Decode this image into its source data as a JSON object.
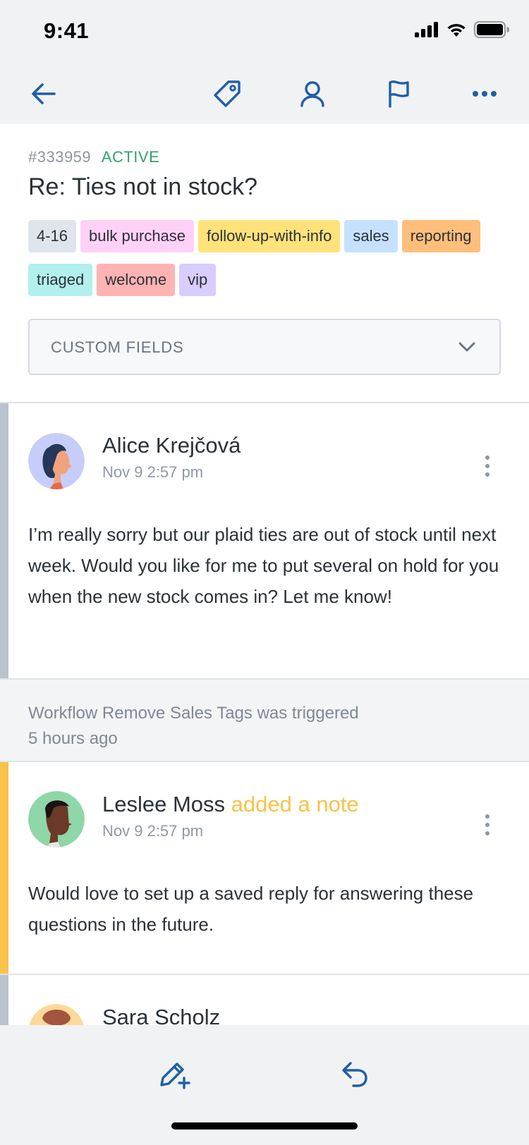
{
  "status_bar": {
    "time": "9:41"
  },
  "nav": {
    "icons": [
      "back-arrow-icon",
      "tag-icon",
      "user-icon",
      "flag-icon",
      "more-horizontal-icon"
    ],
    "accent": "#1f5fa6"
  },
  "conversation": {
    "id": "#333959",
    "status": "ACTIVE",
    "subject": "Re: Ties not in stock?",
    "tags": [
      {
        "label": "4-16",
        "color": "#dfe5eb"
      },
      {
        "label": "bulk purchase",
        "color": "#ffd1f7"
      },
      {
        "label": "follow-up-with-info",
        "color": "#ffe27a"
      },
      {
        "label": "sales",
        "color": "#c6e1ff"
      },
      {
        "label": "reporting",
        "color": "#ffbf7a"
      },
      {
        "label": "triaged",
        "color": "#b1f0ec"
      },
      {
        "label": "welcome",
        "color": "#ffb3b3"
      },
      {
        "label": "vip",
        "color": "#d9ccff"
      }
    ],
    "custom_fields_label": "CUSTOM FIELDS"
  },
  "thread": {
    "message1": {
      "author": "Alice Krejčová",
      "time": "Nov 9 2:57 pm",
      "body": "I’m really sorry but our plaid ties are out of stock until next week. Would you like for me to put several on hold for you when the new stock comes in? Let me know!",
      "bar_color": "#b9c3cd"
    },
    "event": {
      "text": "Workflow Remove Sales Tags was triggered",
      "time": "5 hours ago"
    },
    "note": {
      "author": "Leslee Moss",
      "action": "added a note",
      "time": "Nov 9 2:57 pm",
      "body": "Would love to set up a saved reply for answering these questions in the future.",
      "bar_color": "#f9c24a"
    },
    "message3": {
      "author": "Sara Scholz"
    }
  },
  "bottom_bar": {
    "icons": [
      "compose-note-icon",
      "reply-icon"
    ]
  }
}
